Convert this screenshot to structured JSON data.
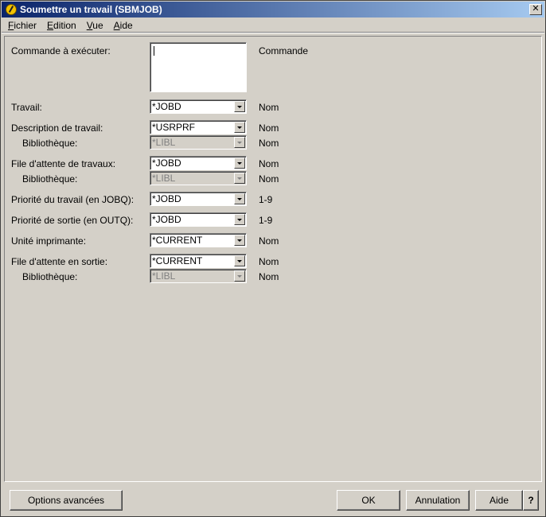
{
  "window": {
    "title": "Soumettre un travail (SBMJOB)",
    "close_glyph": "✕"
  },
  "menu": [
    {
      "u": "F",
      "rest": "ichier"
    },
    {
      "u": "E",
      "rest": "dition"
    },
    {
      "u": "V",
      "rest": "ue"
    },
    {
      "u": "A",
      "rest": "ide"
    }
  ],
  "command": {
    "label": "Commande à exécuter:",
    "hint": "Commande",
    "value": ""
  },
  "fields": {
    "travail": {
      "label": "Travail:",
      "value": "*JOBD",
      "hint": "Nom"
    },
    "job_desc": {
      "label": "Description de travail:",
      "value": "*USRPRF",
      "hint": "Nom"
    },
    "job_desc_lib": {
      "label": "Bibliothèque:",
      "value": "*LIBL",
      "hint": "Nom"
    },
    "job_queue": {
      "label": "File d'attente de travaux:",
      "value": "*JOBD",
      "hint": "Nom"
    },
    "job_queue_lib": {
      "label": "Bibliothèque:",
      "value": "*LIBL",
      "hint": "Nom"
    },
    "job_priority": {
      "label": "Priorité du travail (en JOBQ):",
      "value": "*JOBD",
      "hint": "1-9"
    },
    "output_priority": {
      "label": "Priorité de sortie (en OUTQ):",
      "value": "*JOBD",
      "hint": "1-9"
    },
    "printer": {
      "label": "Unité imprimante:",
      "value": "*CURRENT",
      "hint": "Nom"
    },
    "output_queue": {
      "label": "File d'attente en sortie:",
      "value": "*CURRENT",
      "hint": "Nom"
    },
    "output_queue_lib": {
      "label": "Bibliothèque:",
      "value": "*LIBL",
      "hint": "Nom"
    }
  },
  "buttons": {
    "advanced": "Options avancées",
    "ok": "OK",
    "cancel": "Annulation",
    "help": "Aide",
    "whats_this": "?"
  }
}
